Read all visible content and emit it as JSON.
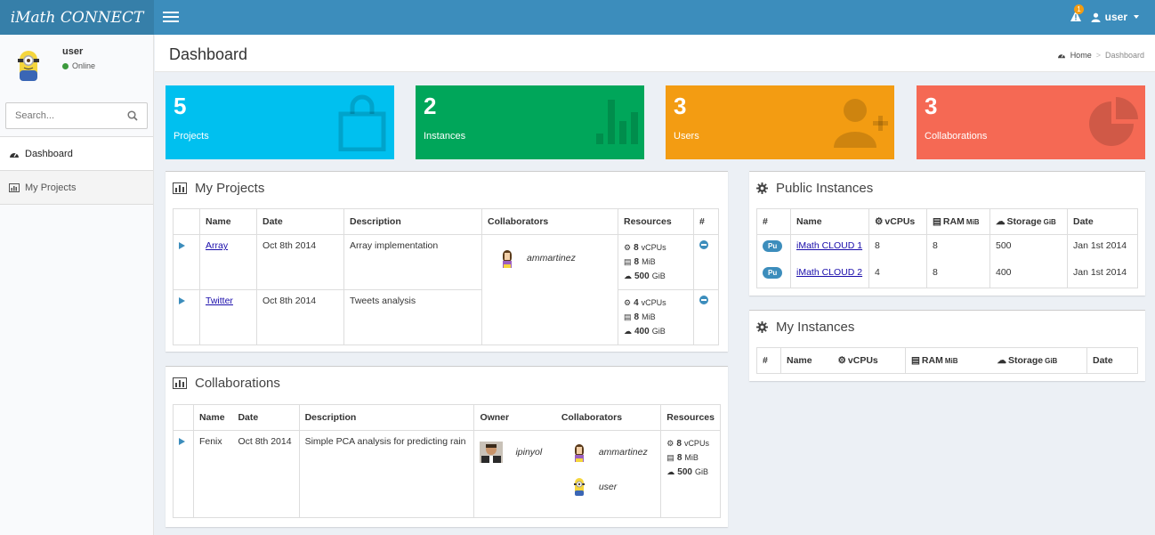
{
  "app": {
    "title": "iMath CONNECT"
  },
  "header": {
    "alert_count": "1",
    "user_label": "user"
  },
  "sidebar": {
    "user_name": "user",
    "status": "Online",
    "search_placeholder": "Search...",
    "items": [
      {
        "label": "Dashboard",
        "icon": "dashboard-icon"
      },
      {
        "label": "My Projects",
        "icon": "bar-chart-icon"
      }
    ]
  },
  "page": {
    "title": "Dashboard",
    "breadcrumb": {
      "home": "Home",
      "current": "Dashboard"
    }
  },
  "stats": [
    {
      "value": "5",
      "label": "Projects",
      "color": "#00c0ef",
      "icon": "shopping-bag-icon"
    },
    {
      "value": "2",
      "label": "Instances",
      "color": "#00a65a",
      "icon": "bar-chart-icon"
    },
    {
      "value": "3",
      "label": "Users",
      "color": "#f39c12",
      "icon": "user-add-icon"
    },
    {
      "value": "3",
      "label": "Collaborations",
      "color": "#f56954",
      "icon": "pie-chart-icon"
    }
  ],
  "my_projects": {
    "title": "My Projects",
    "columns": [
      "Name",
      "Date",
      "Description",
      "Collaborators",
      "Resources",
      "#"
    ],
    "rows": [
      {
        "name": "Array",
        "date": "Oct 8th 2014",
        "description": "Array implementation",
        "vcpus": "8",
        "ram": "8",
        "storage": "500"
      },
      {
        "name": "Twitter",
        "date": "Oct 8th 2014",
        "description": "Tweets analysis",
        "vcpus": "4",
        "ram": "8",
        "storage": "400"
      }
    ],
    "collaborator": "ammartinez"
  },
  "units": {
    "vcpus": "vCPUs",
    "ram": "MiB",
    "storage": "GiB"
  },
  "collaborations": {
    "title": "Collaborations",
    "columns": [
      "Name",
      "Date",
      "Description",
      "Owner",
      "Collaborators",
      "Resources"
    ],
    "row": {
      "name": "Fenix",
      "date": "Oct 8th 2014",
      "description": "Simple PCA analysis for predicting rain",
      "owner": "ipinyol",
      "collaborators": [
        "ammartinez",
        "user"
      ],
      "vcpus": "8",
      "ram": "8",
      "storage": "500"
    }
  },
  "public_instances": {
    "title": "Public Instances",
    "columns": {
      "hash": "#",
      "name": "Name",
      "vcpus": "vCPUs",
      "ram": "RAM",
      "ram_unit": "MiB",
      "storage": "Storage",
      "storage_unit": "GiB",
      "date": "Date"
    },
    "badge": "Pu",
    "rows": [
      {
        "name": "iMath CLOUD 1",
        "vcpus": "8",
        "ram": "8",
        "storage": "500",
        "date": "Jan 1st 2014"
      },
      {
        "name": "iMath CLOUD 2",
        "vcpus": "4",
        "ram": "8",
        "storage": "400",
        "date": "Jan 1st 2014"
      }
    ]
  },
  "my_instances": {
    "title": "My Instances",
    "columns": {
      "hash": "#",
      "name": "Name",
      "vcpus": "vCPUs",
      "ram": "RAM",
      "ram_unit": "MiB",
      "storage": "Storage",
      "storage_unit": "GiB",
      "date": "Date"
    }
  }
}
